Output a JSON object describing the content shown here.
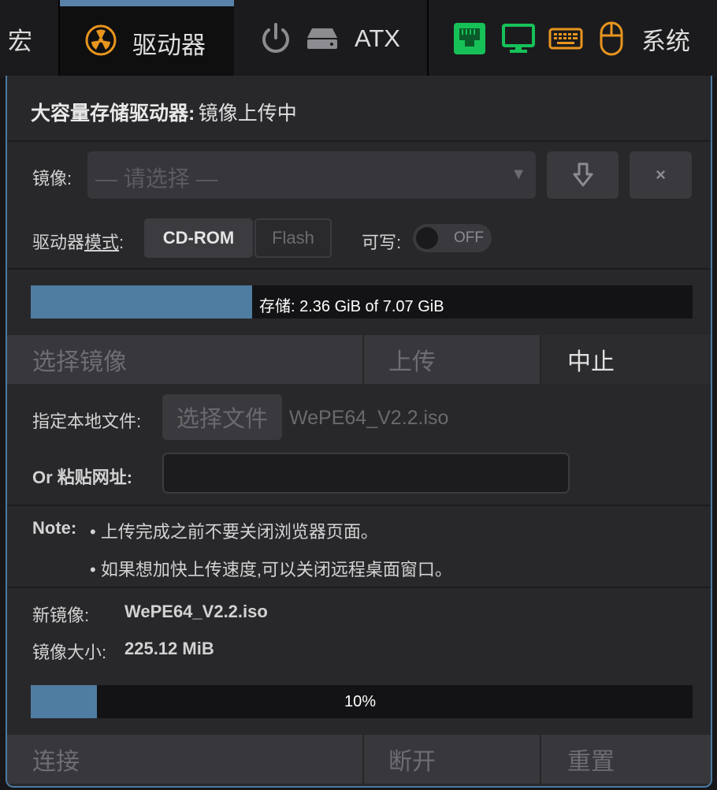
{
  "topbar": {
    "macro_label": "宏",
    "drive_label": "驱动器",
    "atx_label": "ATX",
    "system_label": "系统"
  },
  "colors": {
    "accent": "#4f7ca1",
    "drive_icon": "#e8951e",
    "network_icon": "#16c158",
    "keyboard_icon": "#e8951e"
  },
  "panel": {
    "title_bold": "大容量存储驱动器:",
    "title_status": "镜像上传中",
    "image_label": "镜像:",
    "image_placeholder": "— 请选择 —",
    "mode_label_prefix": "驱动器",
    "mode_label_link": "模式",
    "mode_label_suffix": ":",
    "mode_cdrom": "CD-ROM",
    "mode_flash": "Flash",
    "writable_label": "可写:",
    "writable_state": "OFF",
    "storage_text": "存储: 2.36 GiB of 7.07 GiB",
    "storage_fraction": 0.334,
    "actions1": {
      "select": "选择镜像",
      "upload": "上传",
      "abort": "中止"
    },
    "local_file_label": "指定本地文件:",
    "choose_file": "选择文件",
    "file_name": "WePE64_V2.2.iso",
    "url_label": "Or 粘贴网址:",
    "url_value": "",
    "note_label": "Note:",
    "note_1": "• 上传完成之前不要关闭浏览器页面。",
    "note_2": "• 如果想加快上传速度,可以关闭远程桌面窗口。",
    "new_image_label": "新镜像:",
    "new_image_value": "WePE64_V2.2.iso",
    "image_size_label": "镜像大小:",
    "image_size_value": "225.12 MiB",
    "progress_text": "10%",
    "progress_fraction": 0.1,
    "actions2": {
      "connect": "连接",
      "disconnect": "断开",
      "reset": "重置"
    }
  }
}
